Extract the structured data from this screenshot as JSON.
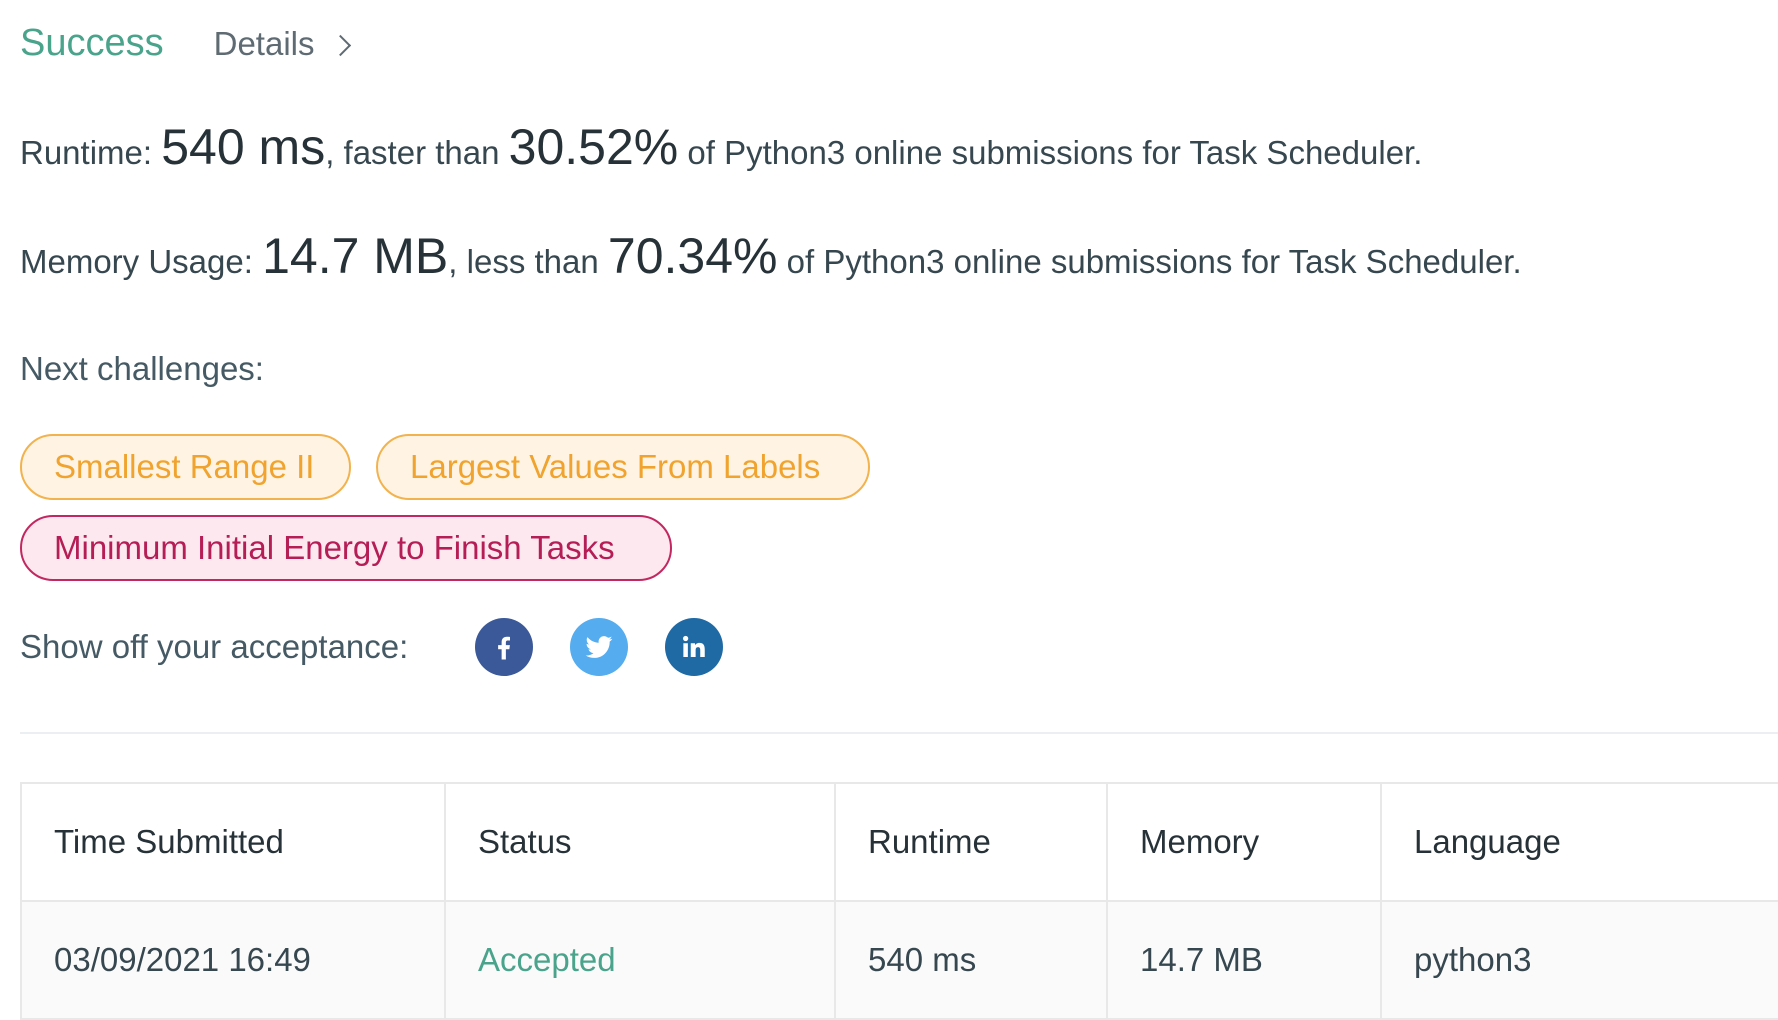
{
  "header": {
    "status": "Success",
    "details_label": "Details"
  },
  "runtime_stat": {
    "label": "Runtime:",
    "value": "540 ms",
    "connector": ", faster than",
    "percent": "30.52%",
    "suffix": "of Python3 online submissions for Task Scheduler."
  },
  "memory_stat": {
    "label": "Memory Usage:",
    "value": "14.7 MB",
    "connector": ", less than",
    "percent": "70.34%",
    "suffix": "of Python3 online submissions for Task Scheduler."
  },
  "next_challenges": {
    "label": "Next challenges:",
    "items": [
      {
        "label": "Smallest Range II",
        "difficulty": "medium"
      },
      {
        "label": "Largest Values From Labels",
        "difficulty": "medium"
      },
      {
        "label": "Minimum Initial Energy to Finish Tasks",
        "difficulty": "hard"
      }
    ]
  },
  "share": {
    "label": "Show off your acceptance:",
    "networks": [
      {
        "icon": "facebook-icon",
        "glyph": "f",
        "color": "#3b5998"
      },
      {
        "icon": "twitter-icon",
        "color": "#55acee"
      },
      {
        "icon": "linkedin-icon",
        "glyph": "in",
        "color": "#1f6aa5"
      }
    ]
  },
  "submissions": {
    "columns": [
      "Time Submitted",
      "Status",
      "Runtime",
      "Memory",
      "Language"
    ],
    "rows": [
      {
        "time": "03/09/2021 16:49",
        "status": "Accepted",
        "runtime": "540 ms",
        "memory": "14.7 MB",
        "language": "python3"
      }
    ]
  },
  "colors": {
    "success": "#4aa38b",
    "medium": "#f0a32e",
    "hard": "#b51d55"
  }
}
